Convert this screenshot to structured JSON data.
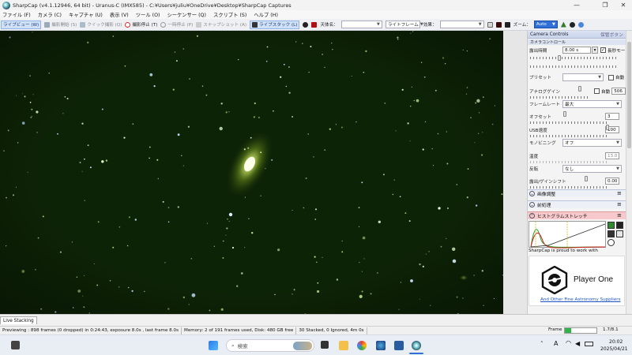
{
  "window": {
    "title": "SharpCap (v4.1.12946, 64 bit) - Uranus-C (IMX585) - C:¥Users¥juliu¥OneDrive¥Desktop¥SharpCap Captures",
    "controls": {
      "minimize": "—",
      "maximize": "❐",
      "close": "✕"
    }
  },
  "menu": [
    "ファイル (F)",
    "カメラ (C)",
    "キャプチャ (U)",
    "表示 (V)",
    "ツール (O)",
    "シーケンサー (Q)",
    "スクリプト (S)",
    "ヘルプ (H)"
  ],
  "toolbar": {
    "live_view": "ライブビュー (W)",
    "start_capture": "撮影開始 (S)",
    "quick_capture": "クイック撮影 (Q)",
    "stop_capture": "撮影停止 (T)",
    "pause": "一時停止 (P)",
    "snapshot": "スナップショット (A)",
    "live_stack": "ライブスタック (L)",
    "target_name_label": "天体名：",
    "target_name_value": "",
    "frame_type": "ライトフレーム",
    "effect_label": "効果：",
    "effect_value": "",
    "zoom_label": "ズーム：",
    "zoom_value": "Auto"
  },
  "panel": {
    "header_title": "Camera Controls",
    "header_right": "保管ボタン",
    "subsection": "カメラコントロール",
    "exposure_label": "露出時間",
    "exposure_value": "8.00 s",
    "long_mode_label": "長秒モード",
    "long_mode_checked": true,
    "preset_label": "プリセット",
    "auto_label": "自動",
    "gain_label": "アナログゲイン",
    "gain_auto": "自動",
    "gain_value": "506",
    "framerate_label": "フレームレート",
    "framerate_value": "最大",
    "offset_label": "オフセット",
    "offset_value": "3",
    "usb_label": "USB速度",
    "usb_value": "100",
    "monobin_label": "モノビニング",
    "monobin_value": "オフ",
    "temp_label": "温度",
    "temp_value": "13.0",
    "flip_label": "反転",
    "flip_value": "なし",
    "timestamp_label": "露出/ゲインシフト",
    "timestamp_value": "0.00",
    "sections": [
      "画像調整",
      "前処理",
      "ヒストグラムストレッチ"
    ],
    "promo_text": "SharpCap is proud to work with",
    "brand_name": "Player One",
    "suppliers_link": "And Other Fine Astronomy Suppliers"
  },
  "live_tab": "Live Stacking",
  "status": {
    "preview": "Previewing : 898 frames (0 dropped) in 0:24:43, exposure 8.0s , last frame 8.0s",
    "memory": "Memory: 2 of 191 frames used, Disk: 480 GB free",
    "stacked": "30 Stacked, 0 Ignored, 4m 0s",
    "frame_label": "Frame",
    "frame_value": "1.7/8.1",
    "frame_progress": 0.21
  },
  "taskbar": {
    "search_placeholder": "検索",
    "time": "20:02",
    "date": "2025/04/21",
    "ime": "A"
  },
  "colors": {
    "sky": "#0b1f04",
    "accent": "#2f6fd6",
    "histogram_header": "#f7c9cc",
    "progress": "#2fb34a"
  }
}
